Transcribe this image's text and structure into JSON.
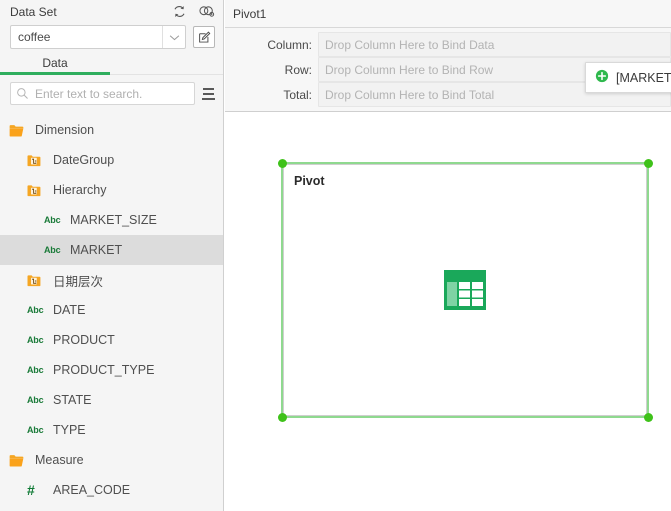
{
  "sidebar": {
    "dataset_title": "Data Set",
    "header_icons": [
      {
        "name": "refresh-icon"
      },
      {
        "name": "relationship-icon"
      }
    ],
    "dataset_value": "coffee",
    "edit_icon": "edit-icon",
    "dropdown_icon": "chevron-down-icon",
    "tabs": [
      {
        "label": "Data",
        "active": true
      }
    ],
    "search": {
      "placeholder": "Enter text to search.",
      "value": "",
      "icon": "search-icon"
    },
    "list_menu_icon": "list-menu-icon",
    "tree": [
      {
        "label": "Dimension",
        "level": 0,
        "icon": "folder-icon",
        "selected": false
      },
      {
        "label": "DateGroup",
        "level": 1,
        "icon": "hierarchy-icon",
        "selected": false
      },
      {
        "label": "Hierarchy",
        "level": 1,
        "icon": "hierarchy-icon",
        "selected": false
      },
      {
        "label": "MARKET_SIZE",
        "level": 2,
        "icon": "abc-icon",
        "selected": false
      },
      {
        "label": "MARKET",
        "level": 2,
        "icon": "abc-icon",
        "selected": true
      },
      {
        "label": "日期层次",
        "level": 1,
        "icon": "hierarchy-icon",
        "selected": false
      },
      {
        "label": "DATE",
        "level": 1,
        "icon": "abc-icon",
        "selected": false
      },
      {
        "label": "PRODUCT",
        "level": 1,
        "icon": "abc-icon",
        "selected": false
      },
      {
        "label": "PRODUCT_TYPE",
        "level": 1,
        "icon": "abc-icon",
        "selected": false
      },
      {
        "label": "STATE",
        "level": 1,
        "icon": "abc-icon",
        "selected": false
      },
      {
        "label": "TYPE",
        "level": 1,
        "icon": "abc-icon",
        "selected": false
      },
      {
        "label": "Measure",
        "level": 0,
        "icon": "folder-icon",
        "selected": false
      },
      {
        "label": "AREA_CODE",
        "level": 1,
        "icon": "hash-icon",
        "selected": false
      }
    ]
  },
  "main": {
    "pivot_title": "Pivot1",
    "bindings": [
      {
        "label": "Column:",
        "placeholder": "Drop Column Here to Bind Data"
      },
      {
        "label": "Row:",
        "placeholder": "Drop Column Here to Bind Row"
      },
      {
        "label": "Total:",
        "placeholder": "Drop Column Here to Bind Total"
      }
    ],
    "drag_ghost": {
      "label": "[MARKET]",
      "icon": "add-circle-icon"
    },
    "widget": {
      "caption": "Pivot",
      "center_icon": "pivot-table-icon",
      "selected": true
    }
  },
  "colors": {
    "accent_green": "#2fae5e",
    "handle_green": "#3fc21a",
    "selection_green": "#8fd98f",
    "folder_orange": "#f5a623",
    "abc_green": "#197a38",
    "sidebar_bg": "#f5f5f5",
    "selected_row": "#dcdcdc"
  }
}
